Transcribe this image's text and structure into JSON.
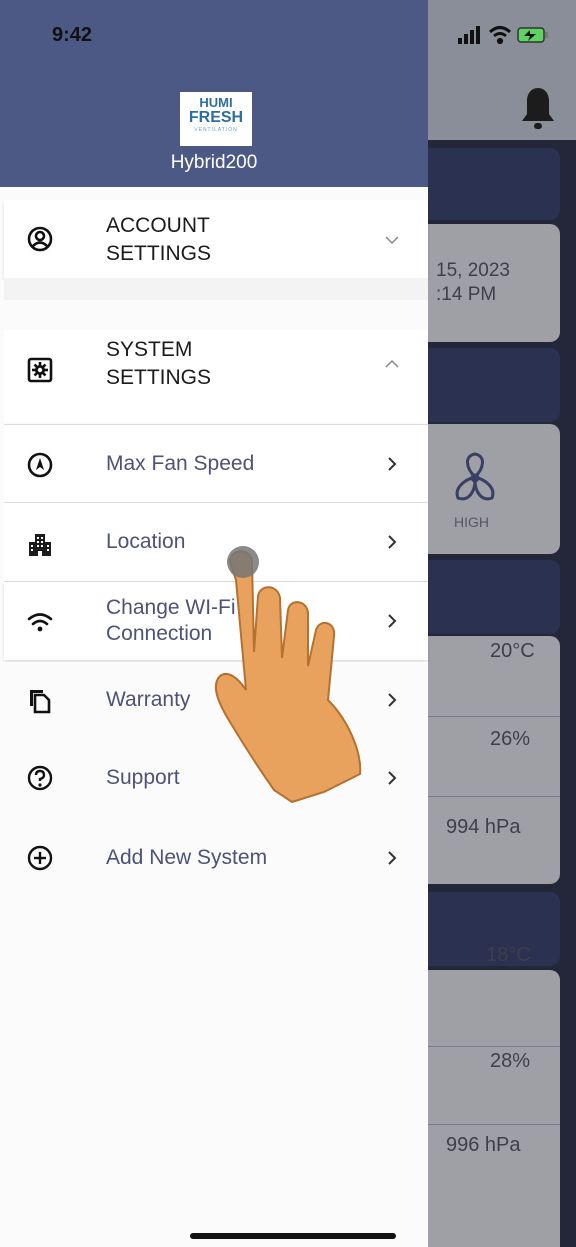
{
  "status_bar": {
    "time": "9:42"
  },
  "drawer": {
    "logo": {
      "line1": "HUMI",
      "line2": "FRESH",
      "line3": "VENTILATION"
    },
    "device_name": "Hybrid200",
    "account_settings": {
      "line1": "ACCOUNT",
      "line2": "SETTINGS"
    },
    "system_settings": {
      "line1": "SYSTEM",
      "line2": "SETTINGS",
      "items": [
        {
          "label": "Max Fan Speed",
          "icon": "compass-icon"
        },
        {
          "label": "Location",
          "icon": "building-icon"
        },
        {
          "label_line1": "Change WI-Fi",
          "label_line2": "Connection",
          "icon": "wifi-icon"
        }
      ]
    },
    "items": [
      {
        "label": "Warranty",
        "icon": "documents-icon"
      },
      {
        "label": "Support",
        "icon": "help-icon"
      },
      {
        "label": "Add New System",
        "icon": "add-circle-icon"
      }
    ]
  },
  "background": {
    "date_line1": "15, 2023",
    "date_line2": ":14 PM",
    "fan_label": "HIGH",
    "readings_1": {
      "temperature": "20°C",
      "humidity": "26%",
      "pressure": "994 hPa"
    },
    "readings_2": {
      "temperature": "18°C",
      "humidity": "28%",
      "pressure": "996 hPa"
    }
  },
  "colors": {
    "drawer_header": "#4d5985",
    "accent_text": "#4c5278",
    "background_dim": "#24273a"
  }
}
